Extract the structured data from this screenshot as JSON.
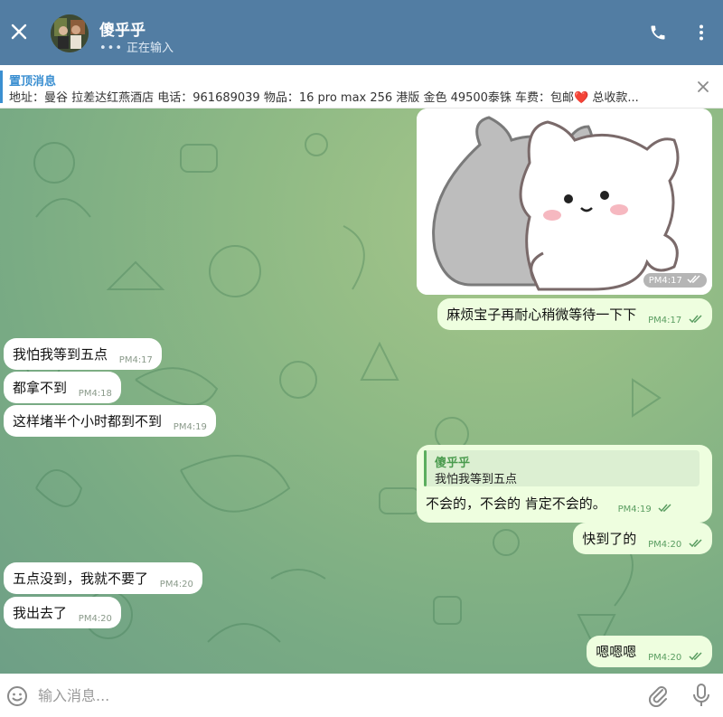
{
  "header": {
    "title": "傻乎乎",
    "status_dots": "•••",
    "status": "正在输入",
    "bg_color": "#527da3"
  },
  "pinned": {
    "title": "置顶消息",
    "text": "地址：曼谷 拉差达红燕酒店 电话：961689039 物品：16 pro max 256 港版 金色 49500泰铢 车费：包邮❤️ 总收款..."
  },
  "icons": {
    "close": "close-icon",
    "call": "phone-icon",
    "menu": "more-vert-icon",
    "pin_close": "close-icon",
    "emoji": "smile-icon",
    "attach": "paperclip-icon",
    "mic": "microphone-icon"
  },
  "messages": {
    "sticker": {
      "time": "PM4:17",
      "read": true
    },
    "m1": {
      "text": "麻烦宝子再耐心稍微等待一下下",
      "time": "PM4:17"
    },
    "m2": {
      "text": "我怕我等到五点",
      "time": "PM4:17"
    },
    "m3": {
      "text": "都拿不到",
      "time": "PM4:18"
    },
    "m4": {
      "text": "这样堵半个小时都到不到",
      "time": "PM4:19"
    },
    "m5": {
      "reply_name": "傻乎乎",
      "reply_text": "我怕我等到五点",
      "text": "不会的，不会的 肯定不会的。",
      "time": "PM4:19"
    },
    "m6": {
      "text": "快到了的",
      "time": "PM4:20"
    },
    "m7": {
      "text": "五点没到，我就不要了",
      "time": "PM4:20"
    },
    "m8": {
      "text": "我出去了",
      "time": "PM4:20"
    },
    "m9": {
      "text": "嗯嗯嗯",
      "time": "PM4:20"
    }
  },
  "composer": {
    "placeholder": "输入消息..."
  },
  "colors": {
    "incoming_bubble": "#ffffff",
    "outgoing_bubble": "#eefedf",
    "read_check": "#5a9d61",
    "pinned_accent": "#3b8fd1"
  }
}
